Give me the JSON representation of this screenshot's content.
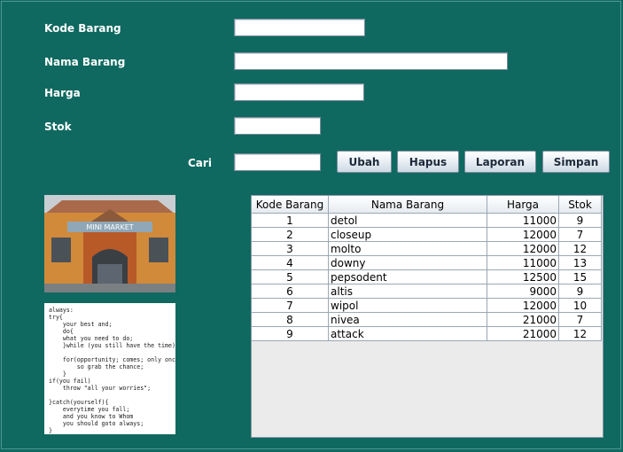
{
  "form": {
    "kode_label": "Kode Barang",
    "nama_label": "Nama Barang",
    "harga_label": "Harga",
    "stok_label": "Stok",
    "cari_label": "Cari",
    "kode_value": "",
    "nama_value": "",
    "harga_value": "",
    "stok_value": "",
    "cari_value": ""
  },
  "buttons": {
    "ubah": "Ubah",
    "hapus": "Hapus",
    "laporan": "Laporan",
    "simpan": "Simpan"
  },
  "table": {
    "columns": [
      "Kode Barang",
      "Nama Barang",
      "Harga",
      "Stok"
    ],
    "rows": [
      [
        "1",
        "detol",
        "11000",
        "9"
      ],
      [
        "2",
        "closeup",
        "12000",
        "7"
      ],
      [
        "3",
        "molto",
        "12000",
        "12"
      ],
      [
        "4",
        "downy",
        "11000",
        "13"
      ],
      [
        "5",
        "pepsodent",
        "12500",
        "15"
      ],
      [
        "6",
        "altis",
        "9000",
        "9"
      ],
      [
        "7",
        "wipol",
        "12000",
        "10"
      ],
      [
        "8",
        "nivea",
        "21000",
        "7"
      ],
      [
        "9",
        "attack",
        "21000",
        "12"
      ]
    ]
  },
  "images": {
    "building_sign": "MINI MARKET",
    "code_text": "always:\ntry{\n    your best and;\n    do{\n    what you need to do;\n    }while (you still have the time);\n\n    for(opportunity; comes; only once){\n        so grab the chance;\n    }\nif(you fail)\n    throw \"all your worries\";\n\n}catch(yourself){\n    everytime you fall;\n    and you know to Whom\n    you should goto always;\n}"
  }
}
